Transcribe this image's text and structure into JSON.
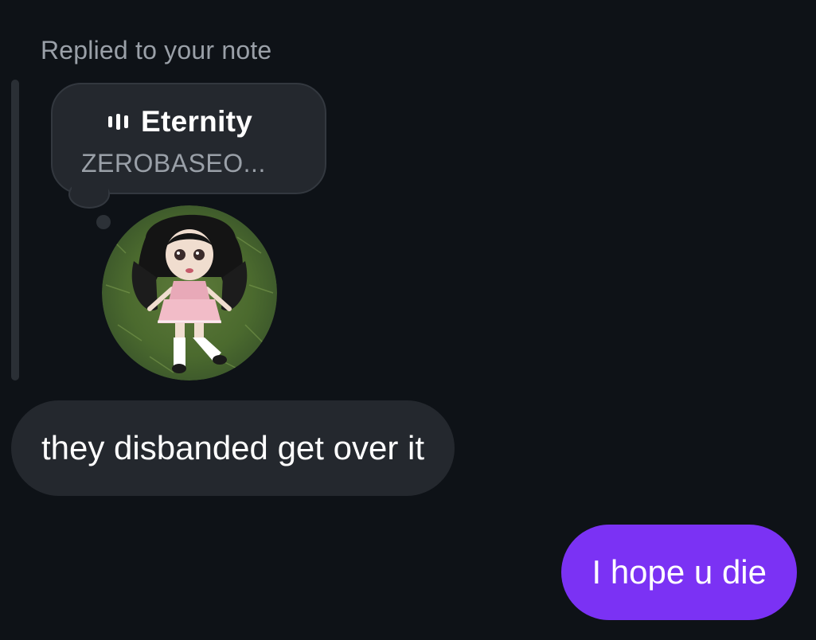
{
  "reply_context": {
    "label": "Replied to your note"
  },
  "note": {
    "icon": "music-bars-icon",
    "title": "Eternity",
    "subtitle": "ZEROBASEO..."
  },
  "avatar": {
    "description_icon": "profile-photo-doll-on-grass"
  },
  "messages": [
    {
      "direction": "incoming",
      "text": "they disbanded get over it"
    },
    {
      "direction": "outgoing",
      "text": "I hope u die"
    }
  ],
  "colors": {
    "background": "#0e1217",
    "incoming_bubble": "#24282e",
    "outgoing_bubble": "#7b32f4",
    "secondary_text": "#9aa0a8",
    "primary_text": "#ffffff"
  }
}
